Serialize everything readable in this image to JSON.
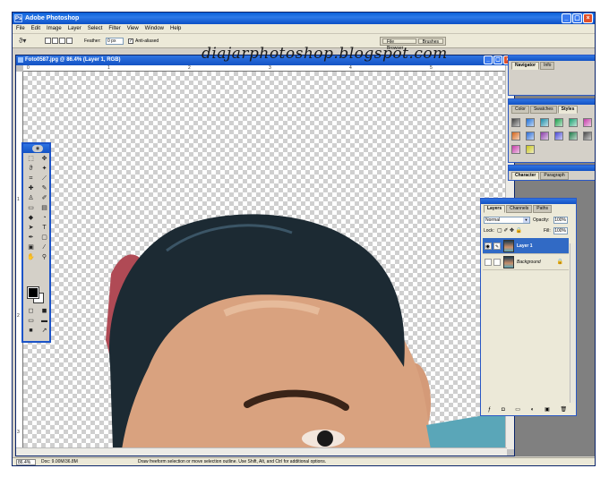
{
  "app": {
    "title": "Adobe Photoshop",
    "icon_label": "Ps"
  },
  "menu": [
    "File",
    "Edit",
    "Image",
    "Layer",
    "Select",
    "Filter",
    "View",
    "Window",
    "Help"
  ],
  "options_bar": {
    "feather_label": "Feather:",
    "feather_value": "0 px",
    "anti_alias_label": "Anti-aliased",
    "anti_alias_checked": true,
    "palette_well_tabs": [
      "File Browser",
      "Brushes"
    ]
  },
  "watermark": "diajarphotoshop.blogspot.com",
  "document": {
    "title": "Foto0587.jpg @ 86.4% (Layer 1, RGB)",
    "ruler_top_ticks": [
      "0",
      "1",
      "2",
      "3",
      "4",
      "5"
    ],
    "ruler_left_ticks": [
      "1",
      "2",
      "3"
    ]
  },
  "toolbox": {
    "tools": [
      {
        "icon": "marquee-icon",
        "glyph": "⬚"
      },
      {
        "icon": "move-icon",
        "glyph": "✥"
      },
      {
        "icon": "lasso-icon",
        "glyph": "ϑ"
      },
      {
        "icon": "magic-wand-icon",
        "glyph": "✦"
      },
      {
        "icon": "crop-icon",
        "glyph": "⌗"
      },
      {
        "icon": "slice-icon",
        "glyph": "⟋"
      },
      {
        "icon": "healing-icon",
        "glyph": "✚"
      },
      {
        "icon": "brush-icon",
        "glyph": "✎"
      },
      {
        "icon": "stamp-icon",
        "glyph": "♙"
      },
      {
        "icon": "history-brush-icon",
        "glyph": "✐"
      },
      {
        "icon": "eraser-icon",
        "glyph": "▭"
      },
      {
        "icon": "gradient-icon",
        "glyph": "▤"
      },
      {
        "icon": "blur-icon",
        "glyph": "◆"
      },
      {
        "icon": "dodge-icon",
        "glyph": "◔"
      },
      {
        "icon": "path-select-icon",
        "glyph": "➤"
      },
      {
        "icon": "type-icon",
        "glyph": "T"
      },
      {
        "icon": "pen-icon",
        "glyph": "✒"
      },
      {
        "icon": "shape-icon",
        "glyph": "▢"
      },
      {
        "icon": "notes-icon",
        "glyph": "▣"
      },
      {
        "icon": "eyedropper-icon",
        "glyph": "⁄"
      },
      {
        "icon": "hand-icon",
        "glyph": "✋"
      },
      {
        "icon": "zoom-icon",
        "glyph": "⚲"
      }
    ],
    "bottom_tools": [
      {
        "icon": "quick-mask-standard-icon",
        "glyph": "◻"
      },
      {
        "icon": "quick-mask-icon",
        "glyph": "◼"
      },
      {
        "icon": "screen-mode-standard-icon",
        "glyph": "▭"
      },
      {
        "icon": "screen-mode-full-menu-icon",
        "glyph": "▬"
      },
      {
        "icon": "screen-mode-full-icon",
        "glyph": "■"
      },
      {
        "icon": "jump-to-imageready-icon",
        "glyph": "↗"
      }
    ]
  },
  "navigator_panel": {
    "tabs": [
      "Navigator",
      "Info"
    ]
  },
  "styles_panel": {
    "tabs": [
      "Color",
      "Swatches",
      "Styles"
    ],
    "active_tab": "Styles",
    "swatches": [
      "#3f3f3f",
      "#1f6fd6",
      "#1a8ca8",
      "#1a9e4a",
      "#1aa070",
      "#c43ca8",
      "#d4641a",
      "#2a6bd4",
      "#8a3ca8",
      "#4a4ad4",
      "#1f7a4a",
      "#4a4a4a",
      "#c43ca8",
      "#c8c41a"
    ]
  },
  "character_panel": {
    "tabs": [
      "Character",
      "Paragraph"
    ]
  },
  "layers_panel": {
    "tabs": [
      "Layers",
      "Channels",
      "Paths"
    ],
    "blend_mode": "Normal",
    "opacity_label": "Opacity:",
    "opacity_value": "100%",
    "lock_label": "Lock:",
    "fill_label": "Fill:",
    "fill_value": "100%",
    "layers": [
      {
        "name": "Layer 1",
        "selected": true,
        "locked": false
      },
      {
        "name": "Background",
        "selected": false,
        "locked": true
      }
    ],
    "bottom_icons": [
      "layer-style-icon",
      "mask-icon",
      "new-set-icon",
      "adjustment-layer-icon",
      "new-layer-icon",
      "trash-icon"
    ]
  },
  "status": {
    "zoom": "86.4%",
    "doc_size": "Doc: 9.00M/36.8M",
    "hint": "Draw freeform selection or move selection outline. Use Shift, Alt, and Ctrl for additional options."
  },
  "colors": {
    "title_bar": "#0a5fd8",
    "selected_layer": "#316ac5",
    "hair": "#1c2a33",
    "skin": "#d9a27f"
  }
}
